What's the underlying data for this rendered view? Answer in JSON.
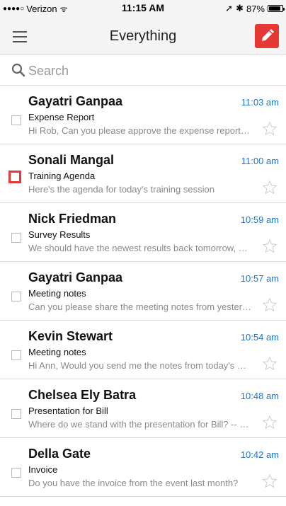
{
  "status_bar": {
    "signal": "●●●●○",
    "carrier": "Verizon",
    "wifi": "ᯤ",
    "time": "11:15 AM",
    "location": "➚",
    "bluetooth": "✱",
    "battery": "87%",
    "battery_level": 0.87
  },
  "nav": {
    "title": "Everything"
  },
  "search": {
    "placeholder": "Search"
  },
  "accent_colors": {
    "compose": "#e53935",
    "time": "#1e73c9",
    "highlight": "#e53935"
  },
  "emails": [
    {
      "sender": "Gayatri Ganpaa",
      "time": "11:03 am",
      "subject": "Expense Report",
      "preview": "Hi Rob, Can you please approve the expense report…"
    },
    {
      "sender": "Sonali Mangal",
      "time": "11:00 am",
      "subject": "Training Agenda",
      "preview": "Here's the agenda for today's training session"
    },
    {
      "sender": "Nick Friedman",
      "time": "10:59 am",
      "subject": "Survey Results",
      "preview": "We should have the newest results back tomorrow, …"
    },
    {
      "sender": "Gayatri Ganpaa",
      "time": "10:57 am",
      "subject": "Meeting notes",
      "preview": "Can you please share the meeting notes from yester…"
    },
    {
      "sender": "Kevin Stewart",
      "time": "10:54 am",
      "subject": "Meeting notes",
      "preview": "Hi Ann, Would you send me the notes from today's …"
    },
    {
      "sender": "Chelsea Ely Batra",
      "time": "10:48 am",
      "subject": "Presentation for Bill",
      "preview": "Where do we stand with the presentation for Bill? -- …"
    },
    {
      "sender": "Della Gate",
      "time": "10:42 am",
      "subject": "Invoice",
      "preview": "Do you have the invoice from the event last month?"
    }
  ]
}
